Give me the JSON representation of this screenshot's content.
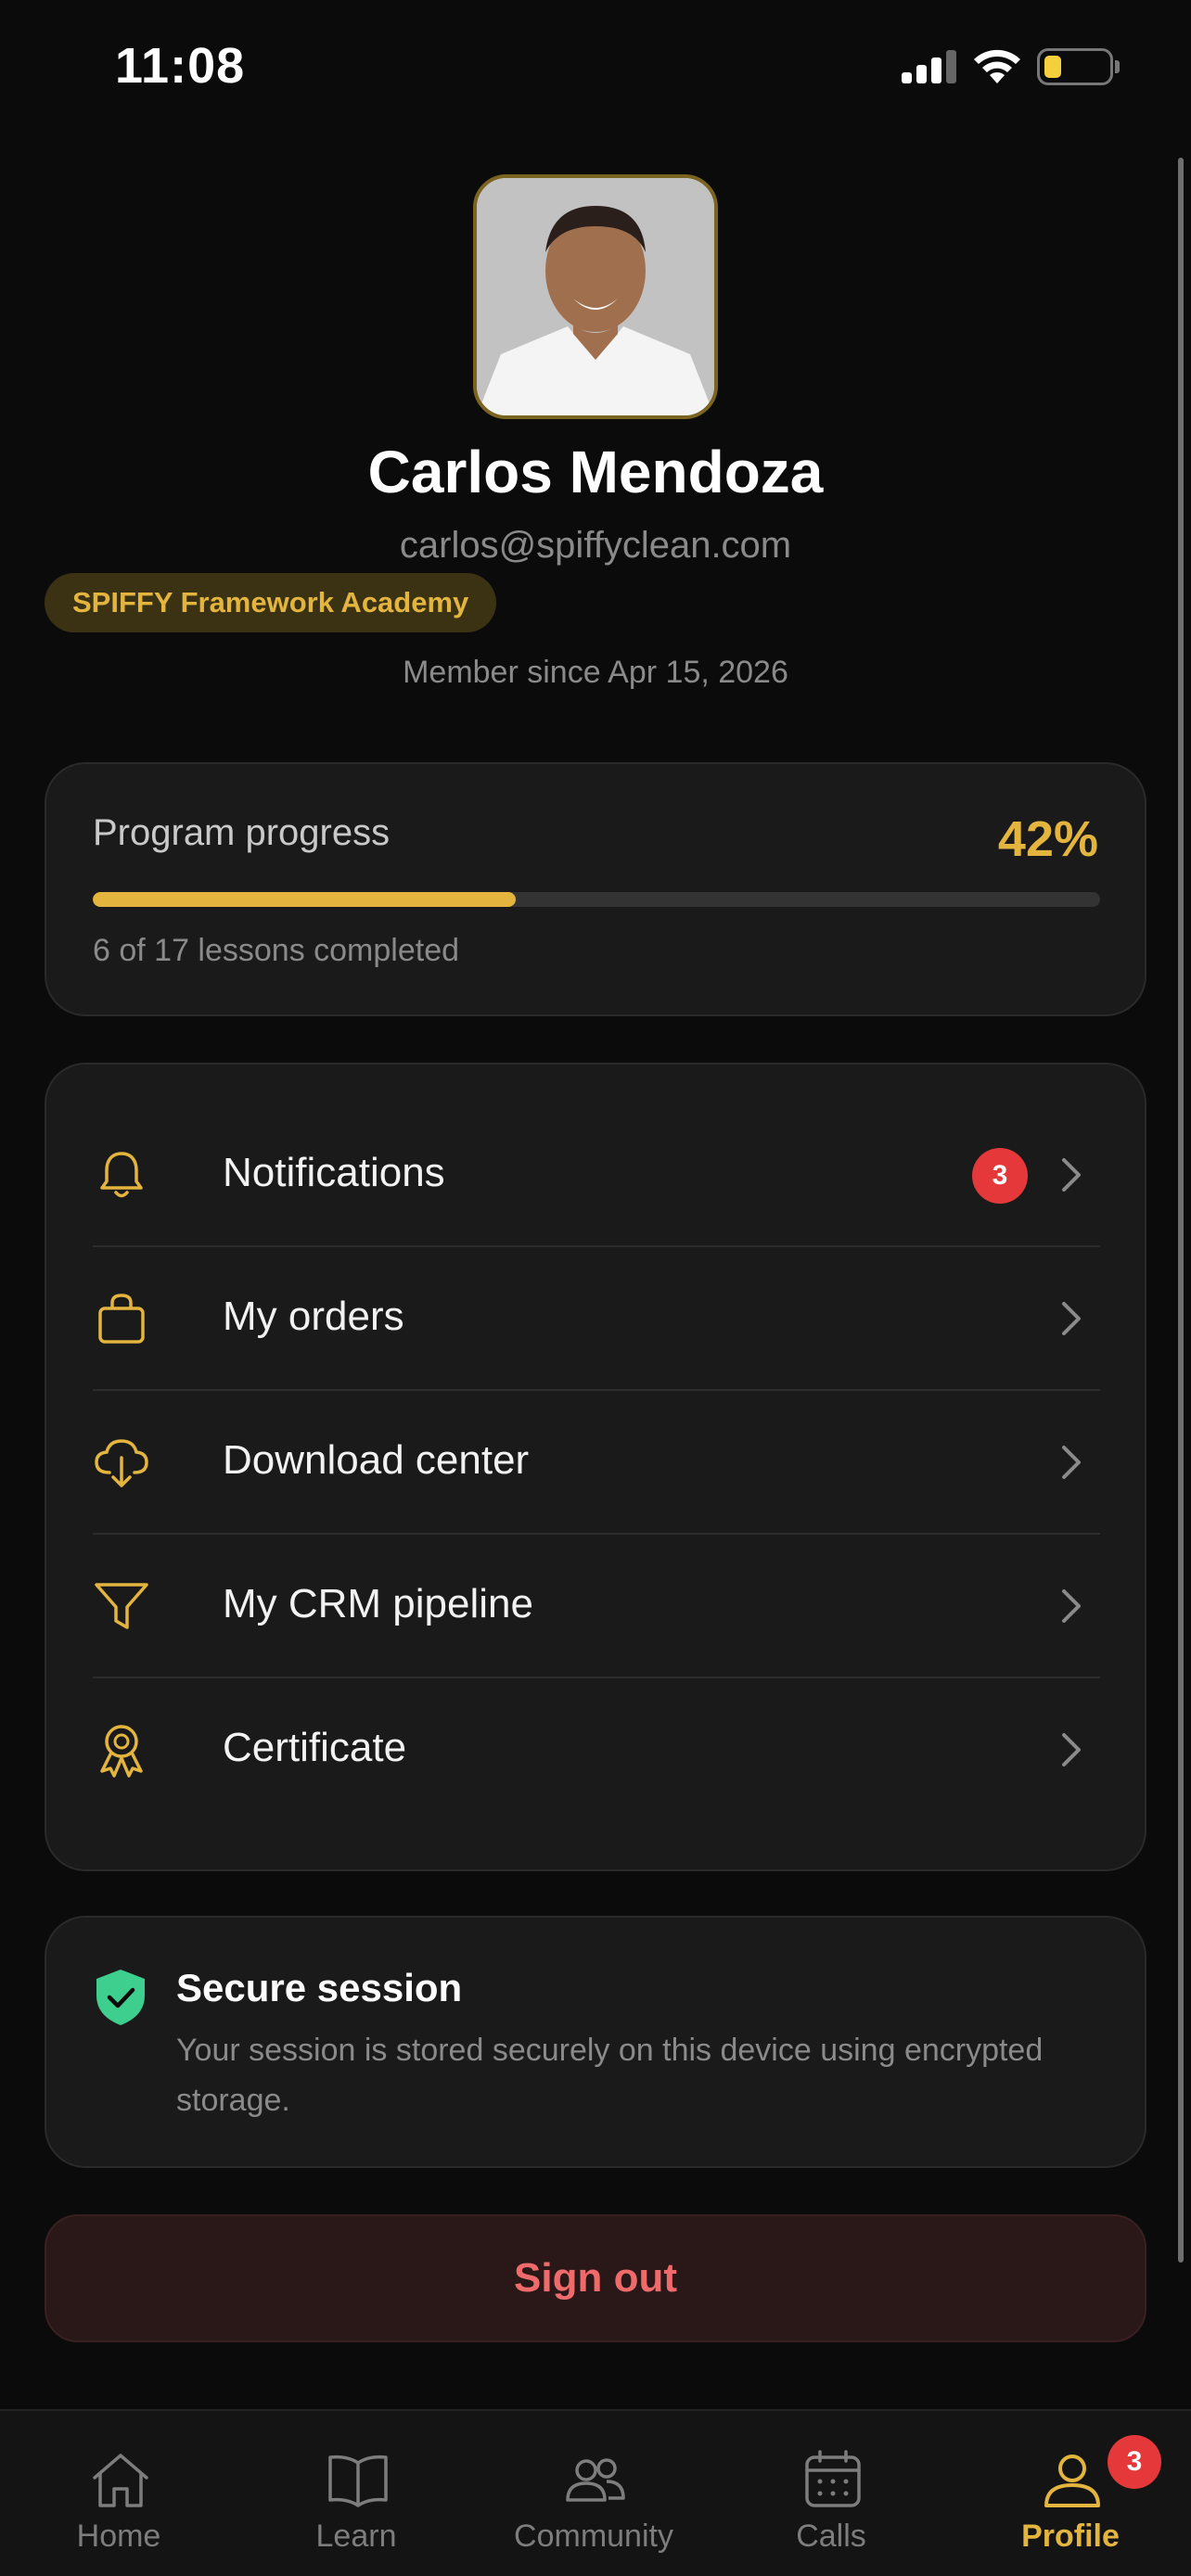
{
  "status_bar": {
    "time": "11:08"
  },
  "profile": {
    "name": "Carlos Mendoza",
    "email": "carlos@spiffyclean.com",
    "badge": "SPIFFY Framework Academy",
    "member_since": "Member since Apr 15, 2026"
  },
  "progress": {
    "label": "Program progress",
    "percent_text": "42%",
    "fraction": 0.42,
    "subtext": "6 of 17 lessons completed"
  },
  "menu": [
    {
      "label": "Notifications",
      "icon": "bell-icon",
      "badge": "3"
    },
    {
      "label": "My orders",
      "icon": "shopping-bag-icon"
    },
    {
      "label": "Download center",
      "icon": "cloud-download-icon"
    },
    {
      "label": "My CRM pipeline",
      "icon": "funnel-icon"
    },
    {
      "label": "Certificate",
      "icon": "award-icon"
    }
  ],
  "secure": {
    "title": "Secure session",
    "text": "Your session is stored securely on this device using encrypted storage."
  },
  "sign_out": "Sign out",
  "tabs": [
    {
      "label": "Home",
      "icon": "home-icon"
    },
    {
      "label": "Learn",
      "icon": "book-icon"
    },
    {
      "label": "Community",
      "icon": "users-icon"
    },
    {
      "label": "Calls",
      "icon": "calendar-icon"
    },
    {
      "label": "Profile",
      "icon": "user-icon",
      "active": true,
      "badge": "3"
    }
  ],
  "colors": {
    "accent": "#e3b53f",
    "badge_red": "#e5383b",
    "shield_green": "#3ecf8e",
    "signout_text": "#ef6b6b"
  }
}
